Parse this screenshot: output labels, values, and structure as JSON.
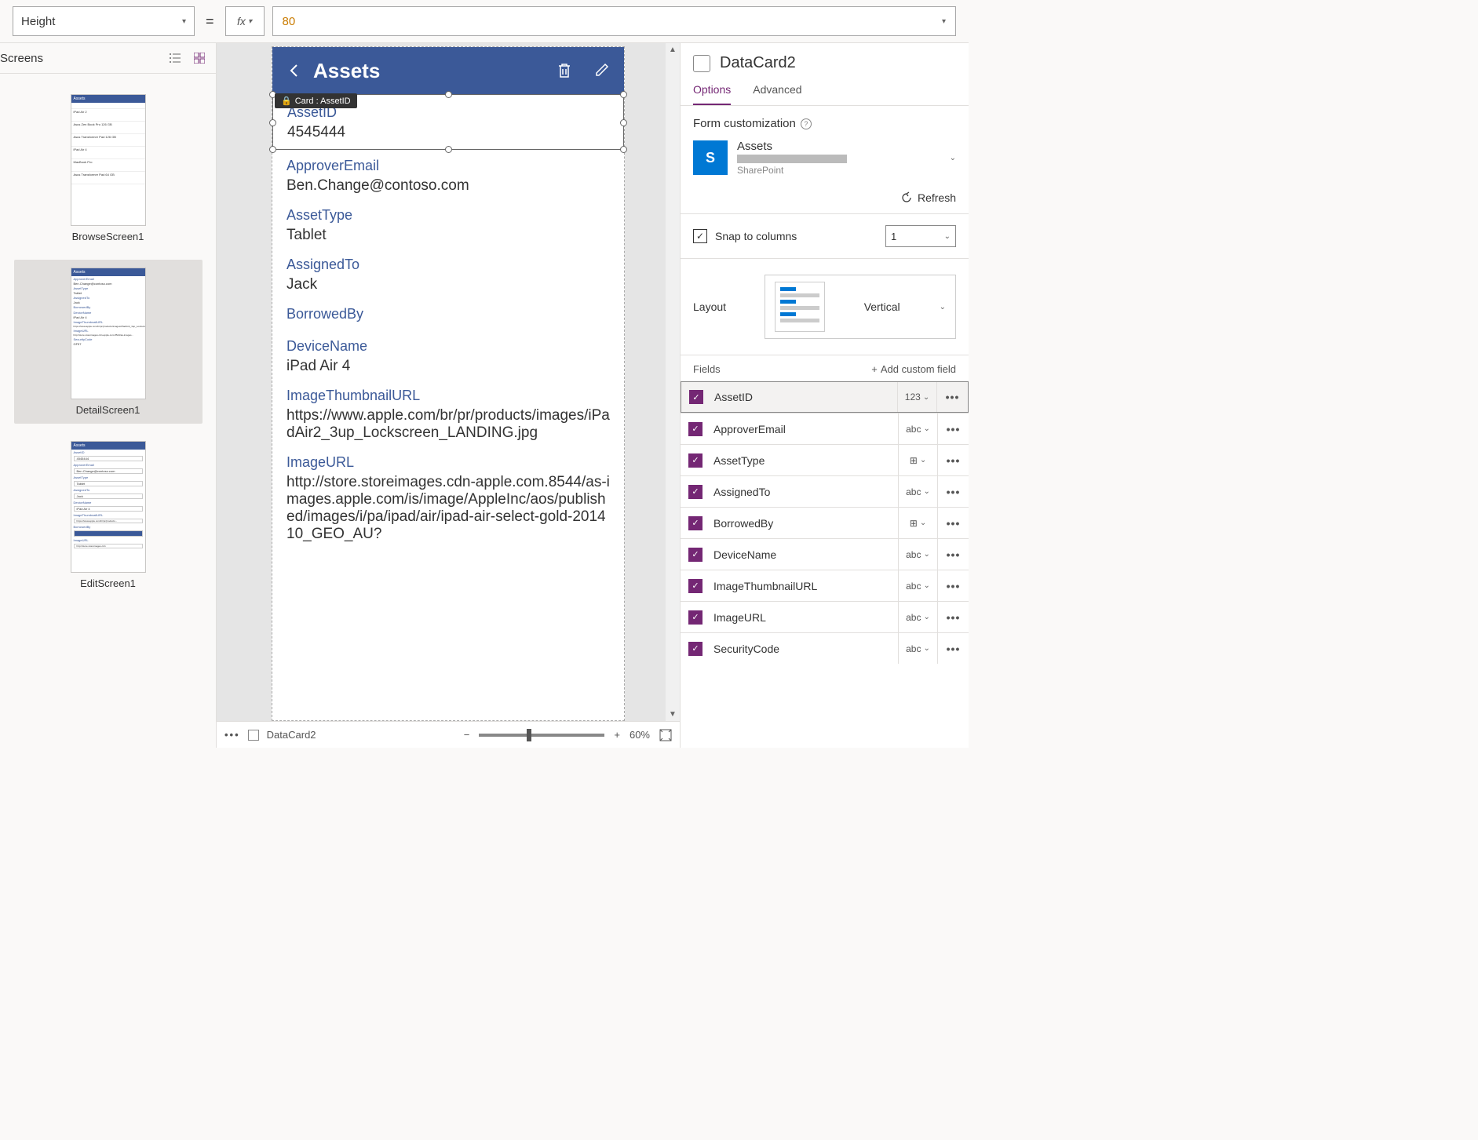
{
  "formulaBar": {
    "property": "Height",
    "fx": "fx",
    "value": "80"
  },
  "screensPanel": {
    "title": "Screens",
    "thumbs": [
      {
        "label": "BrowseScreen1",
        "title": "Assets"
      },
      {
        "label": "DetailScreen1",
        "title": "Assets"
      },
      {
        "label": "EditScreen1",
        "title": "Assets"
      }
    ]
  },
  "canvas": {
    "tooltip": "Card : AssetID",
    "header": {
      "title": "Assets"
    },
    "selectedCard": {
      "label": "AssetID",
      "value": "4545444"
    },
    "cards": [
      {
        "label": "ApproverEmail",
        "value": "Ben.Change@contoso.com"
      },
      {
        "label": "AssetType",
        "value": "Tablet"
      },
      {
        "label": "AssignedTo",
        "value": "Jack"
      },
      {
        "label": "BorrowedBy",
        "value": ""
      },
      {
        "label": "DeviceName",
        "value": "iPad Air 4"
      },
      {
        "label": "ImageThumbnailURL",
        "value": "https://www.apple.com/br/pr/products/images/iPadAir2_3up_Lockscreen_LANDING.jpg"
      },
      {
        "label": "ImageURL",
        "value": "http://store.storeimages.cdn-apple.com.8544/as-images.apple.com/is/image/AppleInc/aos/published/images/i/pa/ipad/air/ipad-air-select-gold-201410_GEO_AU?"
      }
    ]
  },
  "statusBar": {
    "breadcrumb": "DataCard2",
    "zoom": "60%"
  },
  "propsPanel": {
    "title": "DataCard2",
    "tabs": {
      "options": "Options",
      "advanced": "Advanced"
    },
    "formCustomization": "Form customization",
    "datasource": {
      "name": "Assets",
      "provider": "SharePoint"
    },
    "refresh": "Refresh",
    "snapLabel": "Snap to columns",
    "columns": "1",
    "layoutLabel": "Layout",
    "layoutValue": "Vertical",
    "fieldsLabel": "Fields",
    "addCustom": "Add custom field",
    "fields": [
      {
        "name": "AssetID",
        "type": "123",
        "selected": true
      },
      {
        "name": "ApproverEmail",
        "type": "abc"
      },
      {
        "name": "AssetType",
        "type": "⊞"
      },
      {
        "name": "AssignedTo",
        "type": "abc"
      },
      {
        "name": "BorrowedBy",
        "type": "⊞"
      },
      {
        "name": "DeviceName",
        "type": "abc"
      },
      {
        "name": "ImageThumbnailURL",
        "type": "abc"
      },
      {
        "name": "ImageURL",
        "type": "abc"
      },
      {
        "name": "SecurityCode",
        "type": "abc"
      }
    ]
  }
}
